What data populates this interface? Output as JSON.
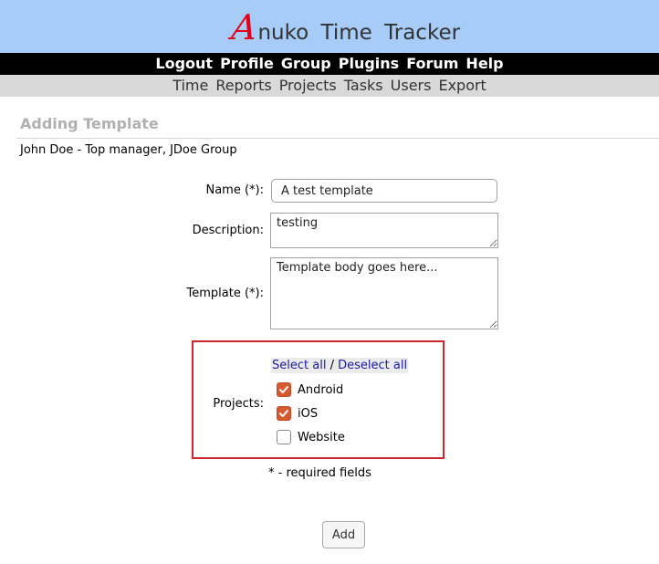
{
  "header": {
    "logo_initial": "A",
    "logo_rest": "nuko Time Tracker"
  },
  "main_nav": [
    "Logout",
    "Profile",
    "Group",
    "Plugins",
    "Forum",
    "Help"
  ],
  "sub_nav": [
    "Time",
    "Reports",
    "Projects",
    "Tasks",
    "Users",
    "Export"
  ],
  "page": {
    "title": "Adding Template",
    "user_line": "John Doe - Top manager, JDoe Group"
  },
  "form": {
    "name_label": "Name (*):",
    "name_value": "A test template",
    "description_label": "Description:",
    "description_value": "testing",
    "template_label": "Template (*):",
    "template_value": "Template body goes here...",
    "projects_label": "Projects:",
    "select_all": "Select all",
    "separator": "/",
    "deselect_all": "Deselect all",
    "projects": [
      {
        "name": "Android",
        "checked": true
      },
      {
        "name": "iOS",
        "checked": true
      },
      {
        "name": "Website",
        "checked": false
      }
    ],
    "required_note": "* - required fields",
    "add_label": "Add"
  },
  "colors": {
    "banner": "#a6ccf7",
    "nav_bar": "#000000",
    "sub_nav_bar": "#d9d9d9",
    "checkbox_checked": "#d65a31",
    "highlight_border": "#d3242c",
    "link": "#1a1aa6"
  }
}
